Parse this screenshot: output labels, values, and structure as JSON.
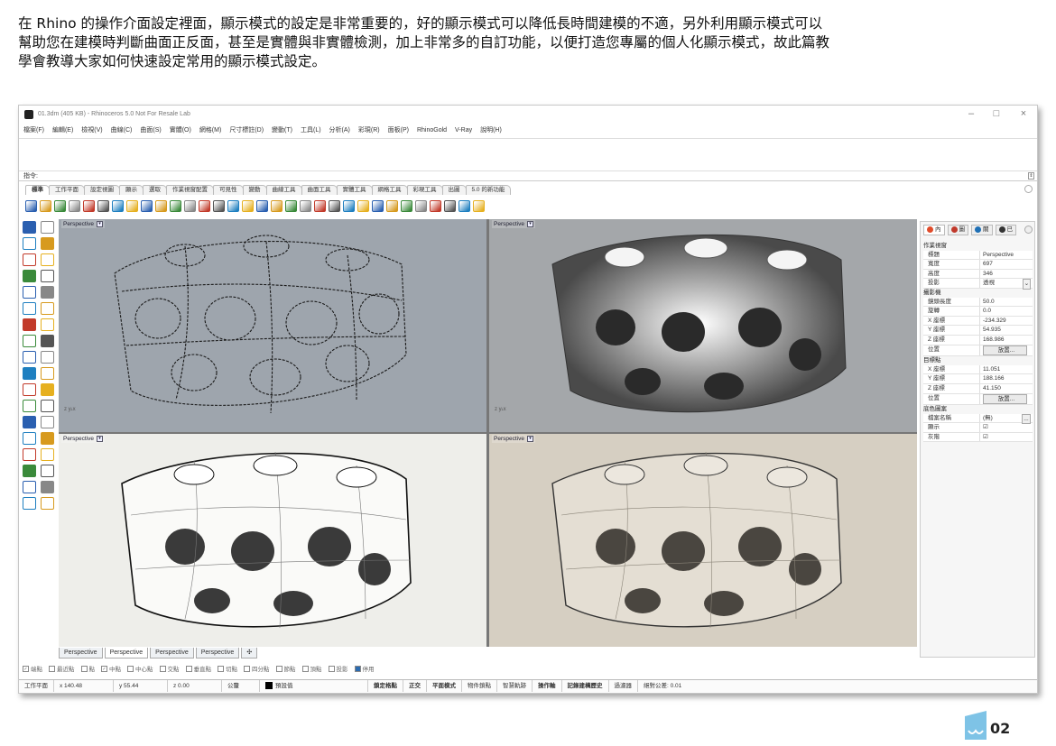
{
  "intro": {
    "paragraph": "在 Rhino 的操作介面設定裡面，顯示模式的設定是非常重要的，好的顯示模式可以降低長時間建模的不適，另外利用顯示模式可以幫助您在建模時判斷曲面正反面，甚至是實體與非實體檢測，加上非常多的自訂功能，以便打造您專屬的個人化顯示模式，故此篇教學會教導大家如何快速設定常用的顯示模式設定。"
  },
  "window": {
    "title": "01.3dm (405 KB) - Rhinoceros 5.0 Not For Resale Lab",
    "minimize": "–",
    "maximize": "□",
    "close": "×"
  },
  "menu": [
    "檔案(F)",
    "編輯(E)",
    "檢視(V)",
    "曲線(C)",
    "曲面(S)",
    "實體(O)",
    "網格(M)",
    "尺寸標註(D)",
    "變動(T)",
    "工具(L)",
    "分析(A)",
    "彩現(R)",
    "面板(P)",
    "RhinoGold",
    "V-Ray",
    "說明(H)"
  ],
  "command": {
    "prompt": "指令:",
    "scroll": "⇕"
  },
  "toolbar_tabs": [
    {
      "label": "標準",
      "active": true
    },
    {
      "label": "工作平面"
    },
    {
      "label": "設定視圖"
    },
    {
      "label": "顯示"
    },
    {
      "label": "選取"
    },
    {
      "label": "作業視窗配置"
    },
    {
      "label": "可見性"
    },
    {
      "label": "變動"
    },
    {
      "label": "曲線工具"
    },
    {
      "label": "曲面工具"
    },
    {
      "label": "實體工具"
    },
    {
      "label": "網格工具"
    },
    {
      "label": "彩現工具"
    },
    {
      "label": "出圖"
    },
    {
      "label": "5.0 的新功能"
    }
  ],
  "toolbar_icons": [
    "new-file",
    "open-folder",
    "save",
    "print",
    "import",
    "cut",
    "copy",
    "paste",
    "undo",
    "pan",
    "rotate-view",
    "zoom-dynamic",
    "zoom-window",
    "zoom-extents",
    "zoom-selected",
    "undo-view",
    "four-viewports",
    "car-render",
    "wire-view",
    "ghosted-view",
    "glasses",
    "light-bulb",
    "lock",
    "layer-color",
    "color-wheel",
    "render-sphere",
    "materials",
    "environment",
    "pin",
    "settings",
    "dimension",
    "help"
  ],
  "tool_colors": [
    "#2a5fb0",
    "#d79a1e",
    "#3a8a3a",
    "#888888",
    "#c23a2a",
    "#555555",
    "#1e7fc0",
    "#e6b020"
  ],
  "viewports": [
    {
      "label": "Perspective",
      "dd": "▾",
      "mode": "wireframe"
    },
    {
      "label": "Perspective",
      "dd": "▾",
      "mode": "rendered"
    },
    {
      "label": "Perspective",
      "dd": "▾",
      "mode": "technical"
    },
    {
      "label": "Perspective",
      "dd": "▾",
      "mode": "pen"
    }
  ],
  "axis": {
    "x": "x",
    "y": "y",
    "z": "z"
  },
  "viewport_tabs": [
    {
      "label": "Perspective"
    },
    {
      "label": "Perspective",
      "active": true
    },
    {
      "label": "Perspective"
    },
    {
      "label": "Perspective"
    },
    {
      "label": "✣"
    }
  ],
  "snaps": [
    {
      "label": "端點",
      "checked": true
    },
    {
      "label": "最近點"
    },
    {
      "label": "點"
    },
    {
      "label": "中點",
      "checked": true
    },
    {
      "label": "中心點"
    },
    {
      "label": "交點"
    },
    {
      "label": "垂直點"
    },
    {
      "label": "切點"
    },
    {
      "label": "四分點"
    },
    {
      "label": "節點"
    },
    {
      "label": "頂點"
    },
    {
      "label": "投影"
    },
    {
      "label": "停用",
      "filled": true
    }
  ],
  "status": {
    "cplane": "工作平面",
    "x": "x 140.48",
    "y": "y 55.44",
    "z": "z 0.00",
    "unit": "公釐",
    "layer": "預設值",
    "grid_snap": "鎖定格點",
    "ortho": "正交",
    "planar": "平面模式",
    "osnap": "物件鎖點",
    "smart_track": "智慧軌跡",
    "gumball": "操作軸",
    "history": "記錄建構歷史",
    "filter": "過濾器",
    "tolerance": "絕對公差: 0.01"
  },
  "panel": {
    "tabs": [
      {
        "label": "內"
      },
      {
        "label": "圖"
      },
      {
        "label": "關"
      },
      {
        "label": "已"
      }
    ],
    "sections": [
      {
        "title": "作業視窗",
        "rows": [
          {
            "k": "標題",
            "v": "Perspective"
          },
          {
            "k": "寬度",
            "v": "697"
          },
          {
            "k": "高度",
            "v": "346"
          },
          {
            "k": "投影",
            "v": "透視",
            "dd": true
          }
        ]
      },
      {
        "title": "攝影機",
        "rows": [
          {
            "k": "鏡頭長度",
            "v": "50.0"
          },
          {
            "k": "旋轉",
            "v": "0.0"
          },
          {
            "k": "X 座標",
            "v": "-234.329"
          },
          {
            "k": "Y 座標",
            "v": "54.935"
          },
          {
            "k": "Z 座標",
            "v": "168.986"
          },
          {
            "k": "位置",
            "v": "放置...",
            "btn": true
          }
        ]
      },
      {
        "title": "目標點",
        "rows": [
          {
            "k": "X 座標",
            "v": "11.051"
          },
          {
            "k": "Y 座標",
            "v": "188.166"
          },
          {
            "k": "Z 座標",
            "v": "41.150"
          },
          {
            "k": "位置",
            "v": "放置...",
            "btn": true
          }
        ]
      },
      {
        "title": "底色圖案",
        "rows": [
          {
            "k": "檔案名稱",
            "v": "(無)",
            "more": "..."
          },
          {
            "k": "顯示",
            "v": "☑"
          },
          {
            "k": "灰階",
            "v": "☑"
          }
        ]
      }
    ]
  },
  "page_number": "02"
}
